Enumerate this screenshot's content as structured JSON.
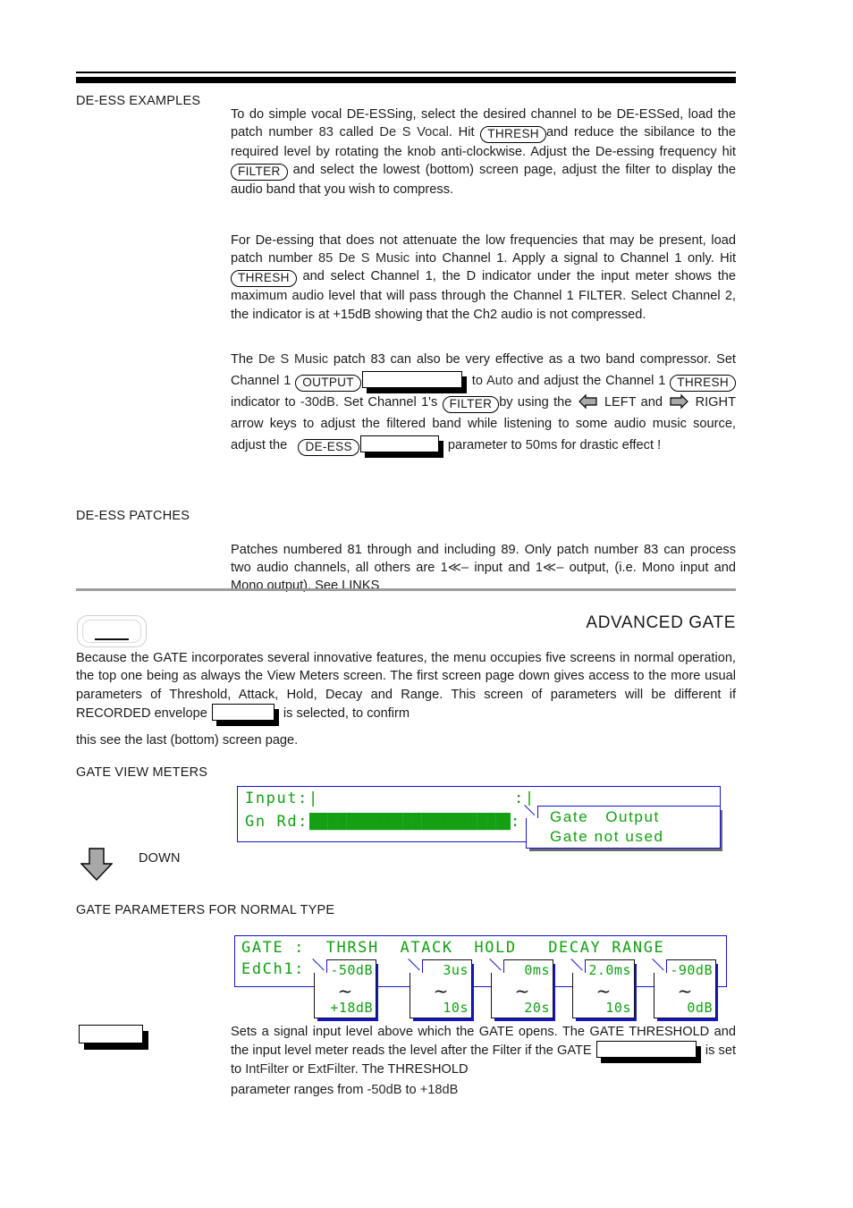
{
  "header": {
    "page_title": "ADVANCED GATE"
  },
  "deess_examples": {
    "label": "DE-ESS EXAMPLES",
    "para1_a": "To do simple vocal DE-ESSing, select the desired channel to be DE-ESSed, load the patch number ",
    "para1_patch": "83",
    "para1_b": " called ",
    "para1_patchname": "De S Vocal",
    "para1_c": ". Hit ",
    "key_thresh": "THRESH",
    "para1_d": "and reduce the sibilance to the required level by rotating the knob anti-clockwise. Adjust the De-essing frequency hit ",
    "key_filter": "FILTER",
    "para1_e": " and select the lowest (bottom) screen page, adjust the filter to display the audio band that you wish to compress.",
    "para2_a": "For De-essing that does not attenuate the low frequencies that may be present, load patch number ",
    "para2_patch": "85 De S Music",
    "para2_b": " into Channel 1. Apply a signal to Channel 1 ",
    "para2_only": "only",
    "para2_c": ". Hit ",
    "para2_d": " and select Channel 1, the ",
    "para2_indicator": "D",
    "para2_e": " indicator under the input meter shows the maximum audio level that will pass through the Channel 1 FILTER.  Select Channel 2, the indicator is at +15dB showing that the Ch2 audio is not compressed.",
    "para3_a": "The ",
    "para3_patchname": "De S Music",
    "para3_b": " patch 83 can also be very effective as a two band compressor. Set Channel 1 ",
    "key_output": "OUTPUT",
    "para3_c": " to ",
    "para3_auto": "Auto",
    "para3_d": " and adjust the Channel 1",
    "para3_e": " indicator to ",
    "para3_minus30": "-30dB",
    "para3_f": ". Set Channel 1's ",
    "para3_g": "by using the ",
    "para3_h": " LEFT and ",
    "para3_i": " RIGHT arrow keys to adjust the filtered band while listening to some audio music source, adjust the ",
    "key_deess": "DE-ESS",
    "para3_j": " parameter to ",
    "para3_50ms": "50ms",
    "para3_k": " for drastic effect !"
  },
  "deess_patches": {
    "label": "DE-ESS PATCHES",
    "para_a": "Patches numbered 81 through and including 89. Only patch number 83 can process two audio channels, all others are ",
    "mono_glyph": "1≪–",
    "para_b": " input and ",
    "para_c": " output, (i.e. Mono input and Mono output). See LINKS"
  },
  "advanced_gate": {
    "intro_a": "Because the GATE incorporates several innovative features, the menu occupies five screens in normal operation, the top one being as always the View Meters screen. The first screen page down gives access to the more usual parameters of Threshold, Attack, Hold, Decay and Range. This screen of parameters ",
    "intro_willbe": "will be",
    "intro_b": " different if RECORDED envelope ",
    "intro_c": " is selected, to confirm",
    "intro_d": "this see the last (bottom) screen page."
  },
  "gate_view_meters": {
    "label": "GATE VIEW METERS",
    "lcd_line1": "Input:|",
    "lcd_line1_right": ":|",
    "lcd_line2_label": "Gn Rd:",
    "lcd_line2_bar": "█████████████████████████████████",
    "lcd_line2_end": ":",
    "popup_line1": "Gate   Output",
    "popup_line2": "Gate not used"
  },
  "down_key": {
    "label": "DOWN",
    "icon": "arrow-down-icon"
  },
  "gate_parameters": {
    "label": "GATE PARAMETERS FOR NORMAL TYPE",
    "lcd_header": "GATE :  THRSH  ATACK  HOLD   DECAY RANGE",
    "lcd_row_label": "EdCh1:",
    "params": [
      {
        "name": "THRSH",
        "min": "-50dB",
        "max": "+18dB"
      },
      {
        "name": "ATACK",
        "min": "3us",
        "max": "10s"
      },
      {
        "name": "HOLD",
        "min": "0ms",
        "max": "20s"
      },
      {
        "name": "DECAY",
        "min": "2.0ms",
        "max": "10s"
      },
      {
        "name": "RANGE",
        "min": "-90dB",
        "max": "0dB"
      }
    ],
    "squiggle": "~"
  },
  "threshold_desc": {
    "para_a": "Sets a signal input level above which the GATE opens. The GATE THRESHOLD and the input level meter reads the level after the Filter if the GATE ",
    "para_b": " is set to ",
    "opt_int": "IntFilter",
    "para_c": " or ",
    "opt_ext": "ExtFilter",
    "para_d": ". The THRESHOLD",
    "para_e": "parameter ranges from ",
    "range_min": "-50dB",
    "para_f": " to ",
    "range_max": "+18dB"
  }
}
